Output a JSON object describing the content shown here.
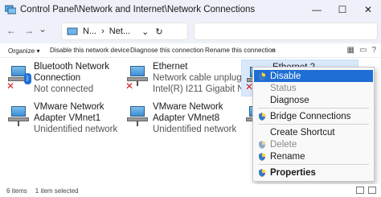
{
  "window": {
    "title": "Control Panel\\Network and Internet\\Network Connections",
    "controls": {
      "minimize": "—",
      "maximize": "☐",
      "close": "✕"
    }
  },
  "address": {
    "back": "←",
    "forward": "→",
    "dropdown": "⌄",
    "crumb1": "N...",
    "crumb_sep": "›",
    "crumb2": "Net...",
    "chevron": "⌄",
    "refresh": "↻"
  },
  "commands": {
    "organize": "Organize ▾",
    "disable": "Disable this network device",
    "diagnose": "Diagnose this connection",
    "rename": "Rename this connection",
    "more": "»"
  },
  "connections": [
    {
      "name": "Bluetooth Network",
      "name2": "Connection",
      "status": "Not connected",
      "icon": "bluetooth-network-icon"
    },
    {
      "name": "Ethernet",
      "status": "Network cable unplugg...",
      "device": "Intel(R) I211 Gigabit Ne...",
      "icon": "ethernet-icon"
    },
    {
      "name": "Ethernet 2",
      "icon": "ethernet-icon"
    },
    {
      "name": "VMware Network",
      "name2": "Adapter VMnet1",
      "status": "Unidentified network",
      "icon": "network-adapter-icon"
    },
    {
      "name": "VMware Network",
      "name2": "Adapter VMnet8",
      "status": "Unidentified network",
      "icon": "network-adapter-icon"
    }
  ],
  "context_menu": {
    "items": [
      {
        "label": "Disable",
        "state": "highlighted",
        "icon": "shield-icon"
      },
      {
        "label": "Status",
        "state": "disabled"
      },
      {
        "label": "Diagnose",
        "state": "normal"
      },
      {
        "label": "Bridge Connections",
        "state": "normal",
        "icon": "shield-icon"
      },
      {
        "label": "Create Shortcut",
        "state": "normal"
      },
      {
        "label": "Delete",
        "state": "disabled",
        "icon": "shield-icon"
      },
      {
        "label": "Rename",
        "state": "normal",
        "icon": "shield-icon"
      },
      {
        "label": "Properties",
        "state": "bold",
        "icon": "shield-icon"
      }
    ]
  },
  "status_bar": {
    "items": "6 items",
    "selected": "1 item selected"
  },
  "colors": {
    "accent": "#1e6ed4",
    "selection": "#d9e8fb",
    "titlebar": "#eef1f9",
    "error": "#d42020"
  }
}
